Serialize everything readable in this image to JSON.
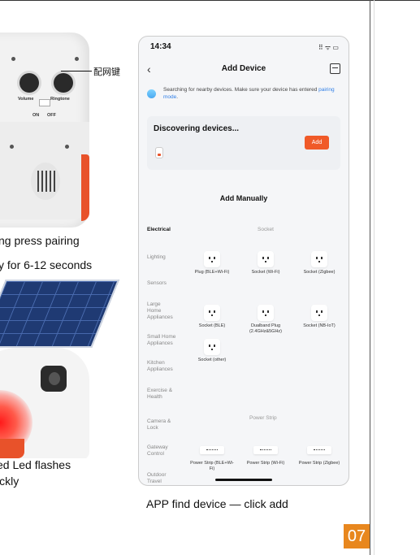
{
  "left": {
    "callout_label": "配网键",
    "device_labels": {
      "volume": "Volume",
      "ringtone": "Ringtone",
      "on": "ON",
      "off": "OFF"
    },
    "caption_top": [
      "ng press pairing",
      "y for 6-12 seconds"
    ],
    "caption_bottom": [
      "ed Led flashes",
      "ickly"
    ]
  },
  "phone": {
    "time": "14:34",
    "status_icons": "⠿ ᯤ ▭",
    "back_glyph": "‹",
    "title": "Add Device",
    "search_text": "Searching for nearby devices. Make sure your device has entered ",
    "search_link": "pairing mode",
    "search_suffix": ".",
    "discovering": "Discovering devices...",
    "add_label": "Add",
    "add_manually": "Add Manually",
    "categories": [
      "Electrical",
      "Lighting",
      "Sensors",
      "Large Home Appliances",
      "Small Home Appliances",
      "Kitchen Appliances",
      "Exercise & Health",
      "Camera & Lock",
      "Gateway Control",
      "Outdoor Travel"
    ],
    "active_category": "Electrical",
    "section_socket": "Socket",
    "section_power_strip": "Power Strip",
    "socket_products": [
      {
        "name": "Plug (BLE+Wi-Fi)"
      },
      {
        "name": "Socket (Wi-Fi)"
      },
      {
        "name": "Socket (Zigbee)"
      },
      {
        "name": "Socket (BLE)"
      },
      {
        "name": "Dualband Plug (2.4GHz&5GHz)"
      },
      {
        "name": "Socket (NB-IoT)"
      },
      {
        "name": "Socket (other)"
      }
    ],
    "strip_products": [
      {
        "name": "Power Strip (BLE+Wi-Fi)"
      },
      {
        "name": "Power Strip (Wi-Fi)"
      },
      {
        "name": "Power Strip (Zigbee)"
      }
    ]
  },
  "caption_phone": "APP find device — click add",
  "page_number": "07",
  "colors": {
    "accent": "#f05a28",
    "badge": "#e8871e",
    "link": "#2f7ee6"
  }
}
